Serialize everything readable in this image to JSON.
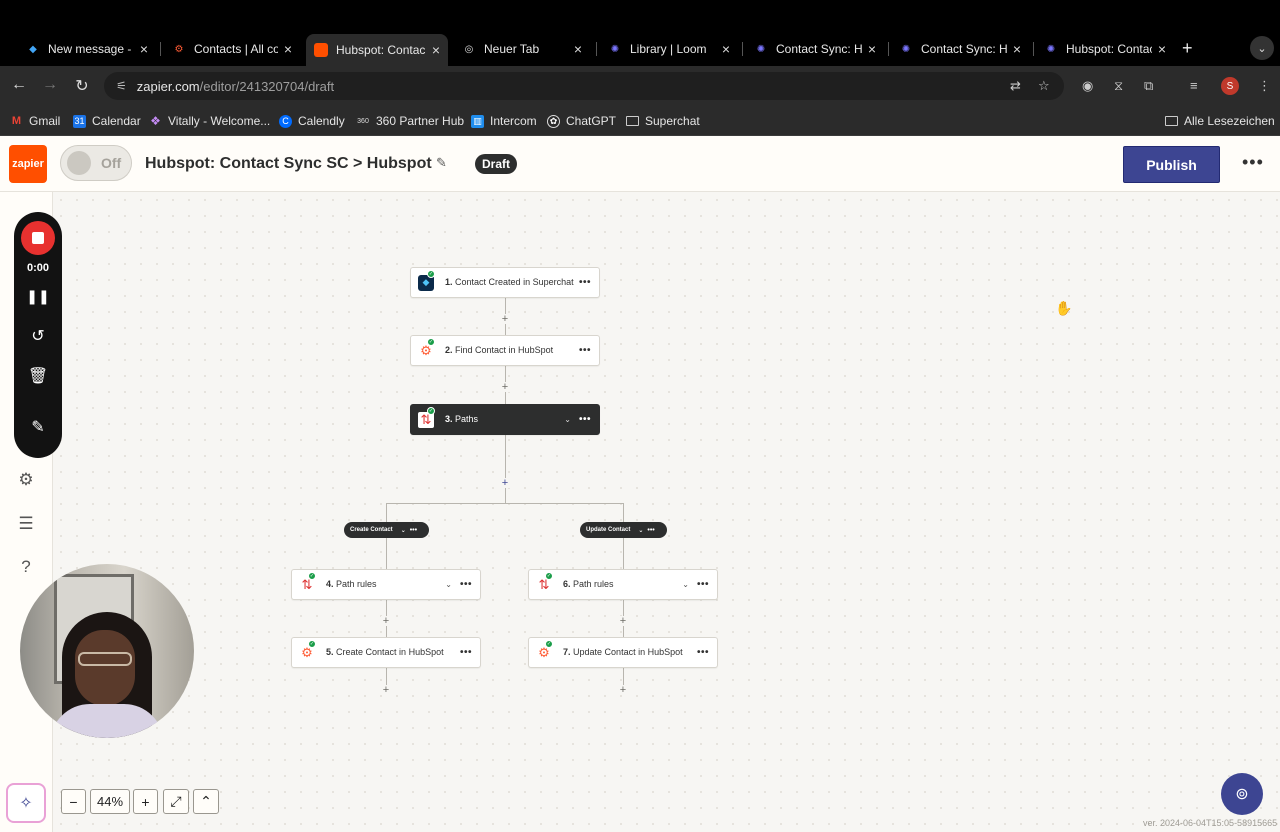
{
  "browser": {
    "tabs": [
      {
        "title": "New message - ",
        "favicon": "superchat-icon",
        "color": "#1e88e5"
      },
      {
        "title": "Contacts | All co",
        "favicon": "hubspot-icon",
        "color": "#ff5c35"
      },
      {
        "title": "Hubspot: Contac",
        "favicon": "zapier-icon",
        "color": "#ff4f00",
        "active": true
      },
      {
        "title": "Neuer Tab",
        "favicon": "chrome-icon",
        "color": "#dddddd"
      },
      {
        "title": "Library | Loom",
        "favicon": "loom-icon",
        "color": "#625df5"
      },
      {
        "title": "Contact Sync: H",
        "favicon": "loom-icon",
        "color": "#625df5"
      },
      {
        "title": "Contact Sync: H",
        "favicon": "loom-icon",
        "color": "#625df5"
      },
      {
        "title": "Hubspot: Contac",
        "favicon": "loom-icon",
        "color": "#625df5"
      }
    ],
    "url_host": "zapier.com",
    "url_path": "/editor/241320704/draft",
    "profile_initial": "S",
    "bookmarks": [
      {
        "label": "Gmail"
      },
      {
        "label": "Calendar"
      },
      {
        "label": "Vitally - Welcome..."
      },
      {
        "label": "Calendly"
      },
      {
        "label": "360 Partner Hub"
      },
      {
        "label": "Intercom"
      },
      {
        "label": "ChatGPT"
      },
      {
        "label": "Superchat"
      }
    ],
    "all_bookmarks": "Alle Lesezeichen"
  },
  "header": {
    "logo": "zapier",
    "toggle_label": "Off",
    "title": "Hubspot: Contact Sync SC > Hubspot",
    "status": "Draft",
    "publish_label": "Publish"
  },
  "recorder": {
    "time": "0:00"
  },
  "steps": [
    {
      "num": "1.",
      "label": "Contact Created in Superchat"
    },
    {
      "num": "2.",
      "label": "Find Contact in HubSpot"
    },
    {
      "num": "3.",
      "label": "Paths"
    },
    {
      "num": "4.",
      "label": "Path rules"
    },
    {
      "num": "5.",
      "label": "Create Contact in HubSpot"
    },
    {
      "num": "6.",
      "label": "Path rules"
    },
    {
      "num": "7.",
      "label": "Update Contact in HubSpot"
    }
  ],
  "branches": [
    {
      "label": "Create Contact"
    },
    {
      "label": "Update Contact"
    }
  ],
  "zoom": {
    "level": "44%"
  },
  "version": "ver. 2024-06-04T15:05-58915665",
  "colors": {
    "zapier_orange": "#ff4f00",
    "publish": "#3d4592",
    "success": "#1a9d49"
  }
}
